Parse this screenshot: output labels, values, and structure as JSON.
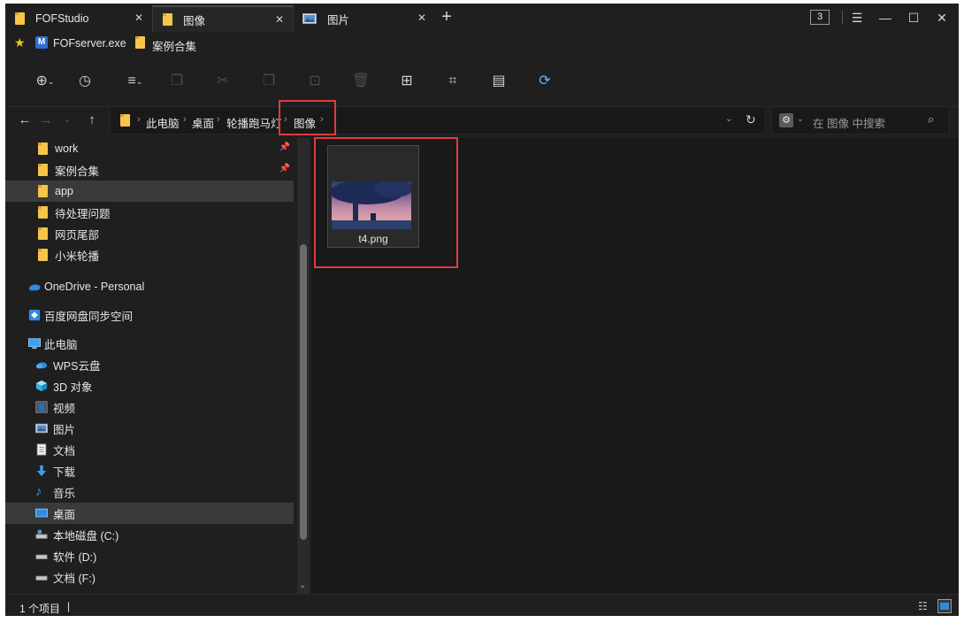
{
  "tabs": [
    {
      "label": "FOFStudio",
      "icon": "folder-icon",
      "active": false
    },
    {
      "label": "图像",
      "icon": "folder-icon",
      "active": true
    },
    {
      "label": "图片",
      "icon": "picture-icon",
      "active": false
    }
  ],
  "tab_count": "3",
  "favorites": [
    {
      "label": "FOFserver.exe",
      "icon": "app-icon"
    },
    {
      "label": "案例合集",
      "icon": "folder-icon"
    }
  ],
  "breadcrumb": [
    "此电脑",
    "桌面",
    "轮播跑马灯",
    "图像"
  ],
  "search": {
    "placeholder": "在 图像 中搜索"
  },
  "sidebar": {
    "quick_access": [
      {
        "label": "work",
        "pinned": true
      },
      {
        "label": "案例合集",
        "pinned": true
      },
      {
        "label": "app",
        "pinned": false,
        "selected": true
      },
      {
        "label": "待处理问题",
        "pinned": false
      },
      {
        "label": "网页尾部",
        "pinned": false
      },
      {
        "label": "小米轮播",
        "pinned": false
      }
    ],
    "onedrive": "OneDrive - Personal",
    "baidu": "百度网盘同步空间",
    "this_pc": "此电脑",
    "pc_items": [
      {
        "label": "WPS云盘",
        "icon": "cloud-icon"
      },
      {
        "label": "3D 对象",
        "icon": "cube-icon"
      },
      {
        "label": "视频",
        "icon": "video-icon"
      },
      {
        "label": "图片",
        "icon": "picture-icon"
      },
      {
        "label": "文档",
        "icon": "document-icon"
      },
      {
        "label": "下载",
        "icon": "download-icon"
      },
      {
        "label": "音乐",
        "icon": "music-icon"
      },
      {
        "label": "桌面",
        "icon": "desktop-icon",
        "selected": true
      },
      {
        "label": "本地磁盘 (C:)",
        "icon": "system-drive-icon"
      },
      {
        "label": "软件 (D:)",
        "icon": "drive-icon"
      },
      {
        "label": "文档 (F:)",
        "icon": "drive-icon"
      }
    ]
  },
  "files": [
    {
      "name": "t4.png",
      "type": "image"
    }
  ],
  "status": {
    "item_count": "1 个项目",
    "separator": "|"
  },
  "colors": {
    "accent": "#e23a3a",
    "folder": "#f6c54a",
    "background": "#1f1f1f",
    "selection": "#3a3a3a"
  }
}
